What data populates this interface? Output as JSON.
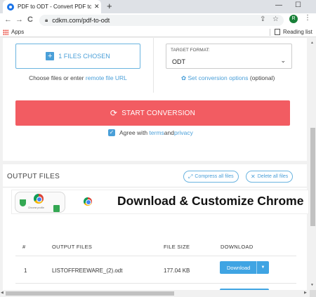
{
  "browser": {
    "tab_title": "PDF to ODT - Convert PDF to OD",
    "tab_close": "✕",
    "new_tab": "+",
    "minimize": "—",
    "maximize": "☐",
    "nav_back": "←",
    "nav_forward": "→",
    "nav_reload": "C",
    "url": "cdkm.com/pdf-to-odt",
    "avatar_letter": "R",
    "menu": "⋮",
    "share_icon": "⇪",
    "star_icon": "☆"
  },
  "bookmarks": {
    "apps_label": "Apps",
    "reading_list": "Reading list"
  },
  "converter": {
    "files_button": "1 FILES CHOSEN",
    "plus": "+",
    "choose_prefix": "Choose files or enter ",
    "choose_link": "remote file URL",
    "target_label": "TARGET FORMAT:",
    "target_value": "ODT",
    "target_chevron": "⌄",
    "gear": "✿",
    "options_link": "Set conversion options",
    "options_suffix": " (optional)",
    "start_label": "START CONVERSION",
    "start_icon": "⟳",
    "agree_prefix": "Agree with ",
    "agree_terms": "terms",
    "agree_and": " and ",
    "agree_privacy": "privacy",
    "check": "✓"
  },
  "output": {
    "title": "OUTPUT FILES",
    "compress_label": "Compress all files",
    "compress_icon": "⤢",
    "delete_label": "Delete all files",
    "delete_icon": "✕",
    "ad_headline": "Download & Customize Chrome",
    "ad_caption": "Chrome profile",
    "columns": [
      "#",
      "OUTPUT FILES",
      "FILE SIZE",
      "DOWNLOAD"
    ],
    "rows": [
      {
        "num": "1",
        "file": "LISTOFFREEWARE_(2).odt",
        "size": "177.04 KB",
        "download": "Download",
        "caret": "▼"
      }
    ]
  },
  "colors": {
    "accent": "#4a9fd8",
    "start_button": "#f25c62",
    "download_button": "#3fa4e3"
  }
}
